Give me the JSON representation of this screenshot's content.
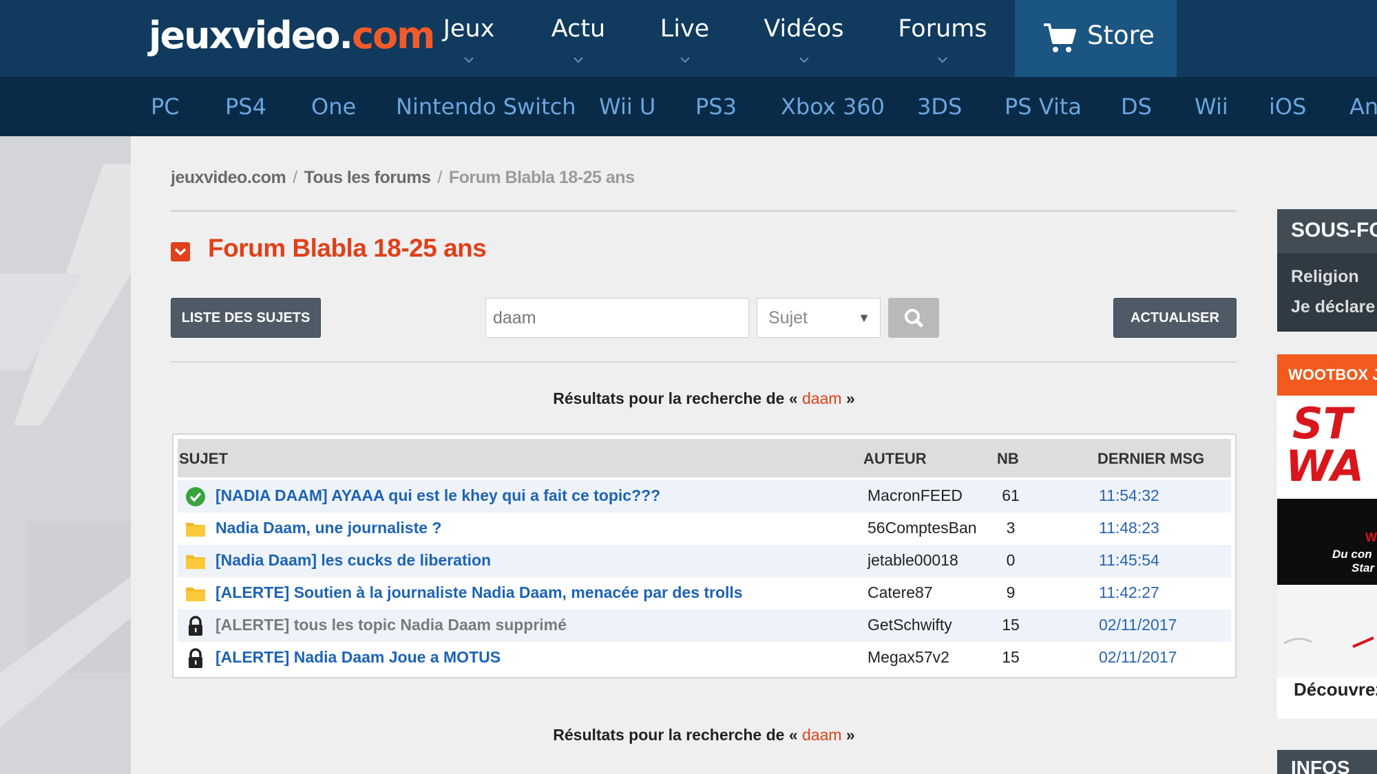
{
  "logo": {
    "part1": "jeuxvideo.",
    "part2": "com"
  },
  "nav": {
    "items": [
      "Jeux",
      "Actu",
      "Live",
      "Vidéos",
      "Forums"
    ],
    "store": "Store"
  },
  "platforms": [
    "PC",
    "PS4",
    "One",
    "Nintendo Switch",
    "Wii U",
    "PS3",
    "Xbox 360",
    "3DS",
    "PS Vita",
    "DS",
    "Wii",
    "iOS",
    "An"
  ],
  "breadcrumb": [
    "jeuxvideo.com",
    "Tous les forums",
    "Forum Blabla 18-25 ans"
  ],
  "breadcrumb_sep": "/",
  "forum_title": "Forum Blabla 18-25 ans",
  "toolbar": {
    "list_button": "LISTE DES SUJETS",
    "refresh_button": "ACTUALISER"
  },
  "search": {
    "value": "daam",
    "select_value": "Sujet"
  },
  "results": {
    "prefix": "Résultats pour la recherche de « ",
    "query": "daam",
    "suffix": " »"
  },
  "table": {
    "headers": {
      "subject": "SUJET",
      "author": "AUTEUR",
      "count": "NB",
      "last": "DERNIER MSG"
    },
    "rows": [
      {
        "icon": "check-icon",
        "subject": "[NADIA DAAM] AYAAA qui est le khey qui a fait ce topic???",
        "author": "MacronFEED",
        "count": "61",
        "last": "11:54:32"
      },
      {
        "icon": "folder-icon",
        "subject": "Nadia Daam, une journaliste ?",
        "author": "56ComptesBan",
        "count": "3",
        "last": "11:48:23"
      },
      {
        "icon": "folder-icon",
        "subject": "[Nadia Daam] les cucks de liberation",
        "author": "jetable00018",
        "count": "0",
        "last": "11:45:54"
      },
      {
        "icon": "folder-icon",
        "subject": "[ALERTE] Soutien à la journaliste Nadia Daam, menacée par des trolls",
        "author": "Catere87",
        "count": "9",
        "last": "11:42:27"
      },
      {
        "icon": "lock-icon",
        "subject": "[ALERTE] tous les topic Nadia Daam supprimé",
        "author": "GetSchwifty",
        "count": "15",
        "last": "02/11/2017"
      },
      {
        "icon": "lock-icon",
        "subject": "[ALERTE] Nadia Daam Joue a MOTUS",
        "author": "Megax57v2",
        "count": "15",
        "last": "02/11/2017"
      }
    ]
  },
  "sidebar": {
    "subforums_title": "SOUS-FO",
    "subforums": [
      "Religion",
      "Je déclare"
    ],
    "promo_title": "WOOTBOX JE",
    "promo_text_1": "WO",
    "promo_text_2": "Du con",
    "promo_text_3": "Star",
    "promo_footer": "Découvrez",
    "infos_title": "INFOS"
  },
  "colors": {
    "nav_bg": "#103a5e",
    "platform_bg": "#0a2b47",
    "accent": "#e0401a",
    "link": "#1c63b6"
  }
}
